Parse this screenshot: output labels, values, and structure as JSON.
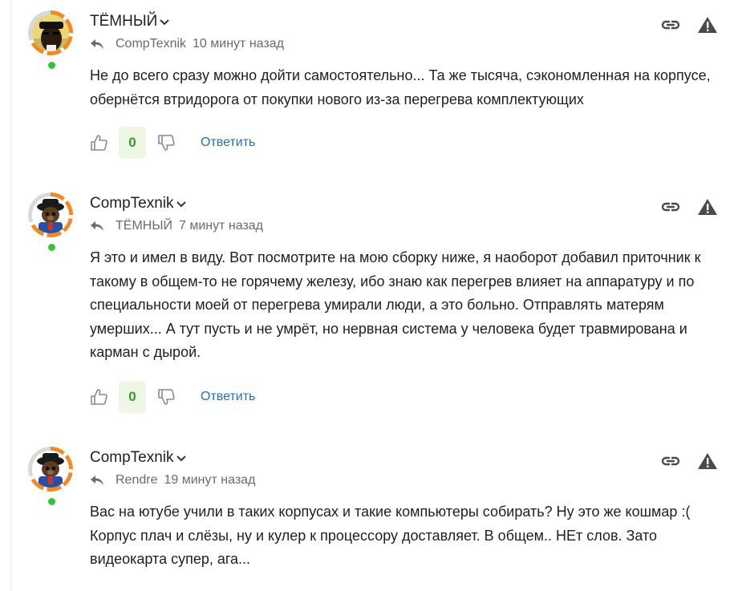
{
  "comments": [
    {
      "author": "ТЁМНЫЙ",
      "reply_to": "CompTexnik",
      "time": "10 минут назад",
      "text": "Не до всего сразу можно дойти самостоятельно... Та же тысяча, сэкономленная на корпусе, обернётся втридорога от покупки нового из-за перегрева комплектующих",
      "score": "0",
      "reply_label": "Ответить"
    },
    {
      "author": "CompTexnik",
      "reply_to": "ТЁМНЫЙ",
      "time": "7 минут назад",
      "text": "Я это и имел в виду. Вот посмотрите на мою сборку ниже, я наоборот добавил приточник к такому в общем-то не горячему железу, ибо знаю как перегрев влияет на аппаратуру и по специальности моей от перегрева умирали люди, а это больно. Отправлять матерям умерших... А тут пусть и не умрёт, но нервная система у человека будет травмирована и карман с дырой.",
      "score": "0",
      "reply_label": "Ответить"
    },
    {
      "author": "CompTexnik",
      "reply_to": "Rendre",
      "time": "19 минут назад",
      "text": "Вас на ютубе учили в таких корпусах и такие компьютеры собирать? Ну это же кошмар :( Корпус плач и слёзы, ну и кулер к процессору доставляет. В общем.. НЕт слов. Зато видеокарта супер, ага..."
    }
  ],
  "colors": {
    "accent_link": "#2b6fa8",
    "score_green": "#3c9a2a",
    "score_bg": "#eef6e6",
    "online": "#3cbf3c",
    "ring": "#f08a24"
  },
  "icons": [
    "chevron-down-icon",
    "reply-arrow-icon",
    "link-icon",
    "warning-icon",
    "thumb-up-icon",
    "thumb-down-icon"
  ]
}
